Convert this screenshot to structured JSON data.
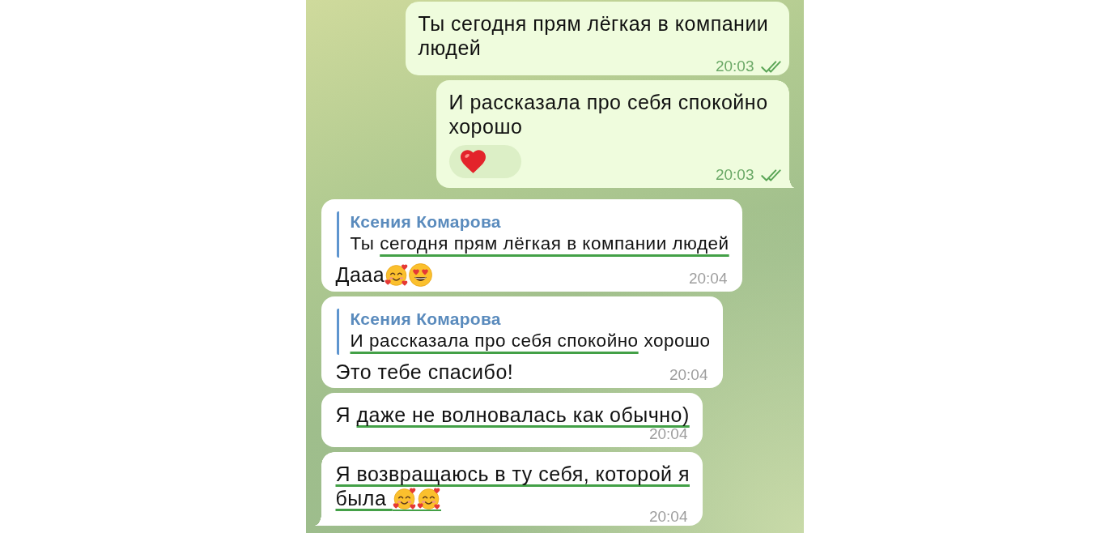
{
  "chat": {
    "messages": [
      {
        "kind": "outgoing",
        "tail": false,
        "segments": [
          {
            "text": "Ты сегодня прям лёгкая в компании людей",
            "underlined": false
          }
        ],
        "time": "20:03",
        "read": true
      },
      {
        "kind": "outgoing",
        "tail": true,
        "segments": [
          {
            "text": "И рассказала про себя спокойно хорошо",
            "underlined": false
          }
        ],
        "reactions": [
          {
            "kind": "heart"
          }
        ],
        "time": "20:03",
        "read": true
      },
      {
        "kind": "incoming",
        "tail": false,
        "reply": {
          "author": "Ксения Комарова",
          "segments": [
            {
              "text": "Ты ",
              "underlined": false
            },
            {
              "text": "сегодня прям лёгкая в компании людей",
              "underlined": true
            }
          ]
        },
        "segments": [
          {
            "text": "Дааа",
            "underlined": false
          }
        ],
        "emoji": [
          {
            "kind": "smiling-face-with-hearts",
            "underlined": false
          },
          {
            "kind": "heart-eyes",
            "underlined": false
          }
        ],
        "time": "20:04"
      },
      {
        "kind": "incoming",
        "tail": false,
        "reply": {
          "author": "Ксения Комарова",
          "segments": [
            {
              "text": "И рассказала про себя спокойно",
              "underlined": true
            },
            {
              "text": " хорошо",
              "underlined": false
            }
          ]
        },
        "segments": [
          {
            "text": "Это тебе спасибо!",
            "underlined": false
          }
        ],
        "time": "20:04"
      },
      {
        "kind": "incoming",
        "tail": false,
        "segments": [
          {
            "text": "Я ",
            "underlined": false
          },
          {
            "text": "даже не волновалась как обычно)",
            "underlined": true
          }
        ],
        "time": "20:04"
      },
      {
        "kind": "incoming",
        "tail": true,
        "segments": [
          {
            "text": "Я возвращаюсь в ту себя, которой я была ",
            "underlined": true
          }
        ],
        "emoji": [
          {
            "kind": "smiling-face-with-hearts",
            "underlined": true
          },
          {
            "kind": "smiling-face-with-hearts",
            "underlined": true
          }
        ],
        "time": "20:04"
      }
    ]
  }
}
